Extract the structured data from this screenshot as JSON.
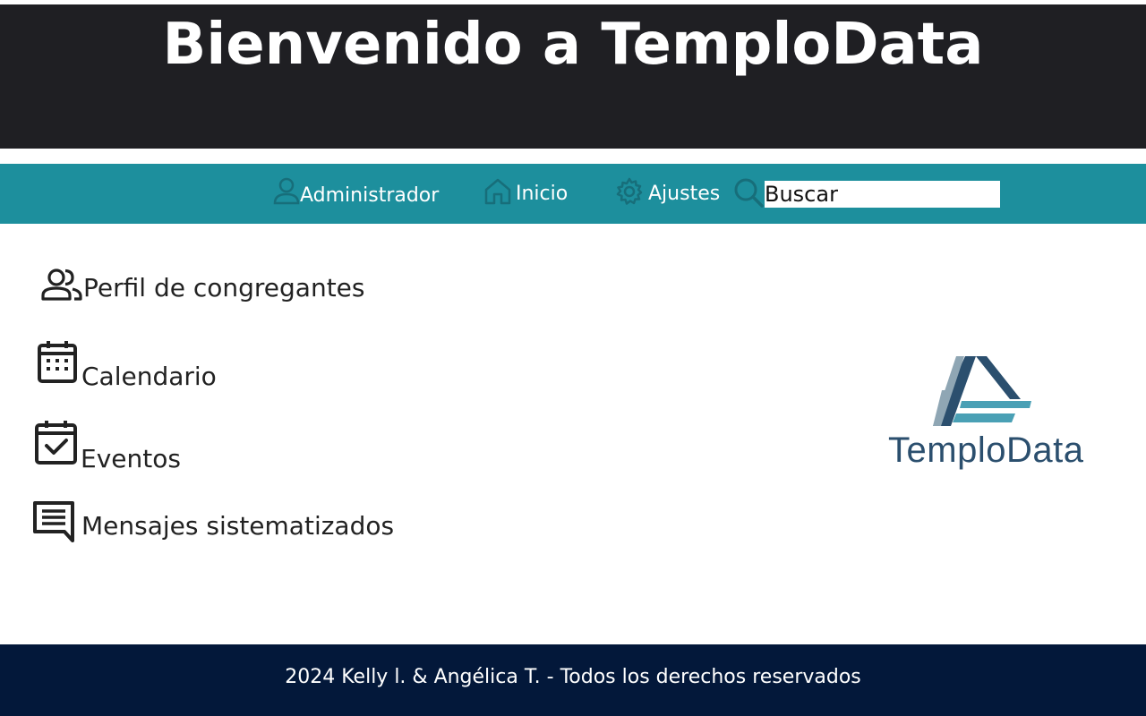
{
  "header": {
    "title": "Bienvenido a TemploData"
  },
  "navbar": {
    "items": [
      {
        "label": "Administrador",
        "icon": "user-icon"
      },
      {
        "label": "Inicio",
        "icon": "home-icon"
      },
      {
        "label": "Ajustes",
        "icon": "gear-icon"
      }
    ],
    "search": {
      "icon": "search-icon",
      "value": "Buscar"
    }
  },
  "menu": {
    "items": [
      {
        "label": "Perfil de congregantes",
        "icon": "users-icon"
      },
      {
        "label": "Calendario",
        "icon": "calendar-icon"
      },
      {
        "label": "Eventos",
        "icon": "calendar-check-icon"
      },
      {
        "label": "Mensajes sistematizados",
        "icon": "message-icon"
      }
    ]
  },
  "logo": {
    "text": "TemploData"
  },
  "footer": {
    "text": "2024 Kelly l. & Angélica T. - Todos los derechos reservados"
  },
  "colors": {
    "header_bg": "#1f1f23",
    "navbar_bg": "#1d8f9d",
    "footer_bg": "#03183a",
    "logo_dark": "#2b4f6e",
    "logo_light": "#4aa0b5"
  }
}
